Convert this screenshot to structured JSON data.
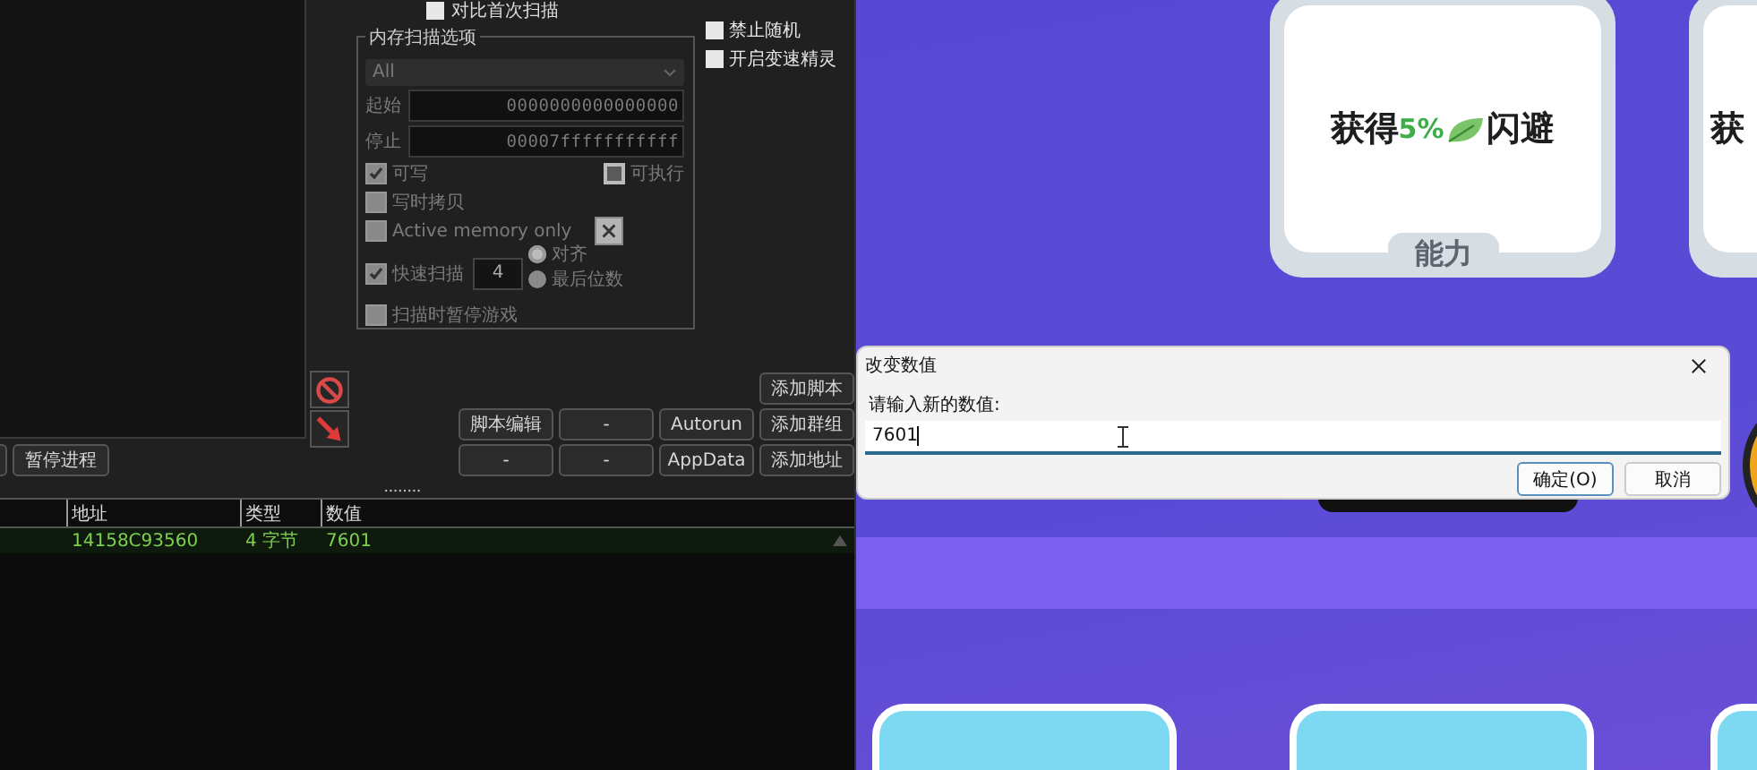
{
  "scan_panel": {
    "compare_first_scan": {
      "label": "对比首次扫描",
      "checked": false
    },
    "memory_scan_options": {
      "title": "内存扫描选项",
      "disabled": true,
      "region": "All",
      "start_label": "起始",
      "start": "0000000000000000",
      "stop_label": "停止",
      "stop": "00007fffffffffff",
      "writable": {
        "label": "可写",
        "checked": true
      },
      "executable": {
        "label": "可执行",
        "checked": false
      },
      "copy_on_write": {
        "label": "写时拷贝",
        "checked": false
      },
      "active_memory_only": {
        "label": "Active memory only",
        "checked": false
      },
      "fast_scan": {
        "label": "快速扫描",
        "checked": true,
        "value": "4"
      },
      "alignment": [
        {
          "label": "对齐",
          "selected": true
        },
        {
          "label": "最后位数",
          "selected": false
        }
      ],
      "pause_game": {
        "label": "扫描时暂停游戏",
        "checked": false
      }
    },
    "right_options": [
      {
        "label": "禁止随机",
        "checked": false
      },
      {
        "label": "开启变速精灵",
        "checked": false
      }
    ],
    "pause_process": "暂停进程",
    "button_rows": [
      [
        "添加脚本"
      ],
      [
        "脚本编辑",
        "-",
        "Autorun",
        "添加群组"
      ],
      [
        "-",
        "-",
        "AppData",
        "添加地址"
      ]
    ]
  },
  "table": {
    "columns": [
      "地址",
      "类型",
      "数值"
    ],
    "rows": [
      {
        "address": "14158C93560",
        "type": "4 字节",
        "value": "7601"
      }
    ]
  },
  "game": {
    "cards": [
      {
        "before": "获得",
        "highlight": "5%",
        "after": "闪避",
        "tab": "能力"
      },
      {
        "before": "获"
      }
    ]
  },
  "dialog": {
    "title": "改变数值",
    "prompt": "请输入新的数值:",
    "value": "7601",
    "buttons": [
      {
        "label": "确定(O)",
        "default": true
      },
      {
        "label": "取消",
        "default": false
      }
    ]
  }
}
